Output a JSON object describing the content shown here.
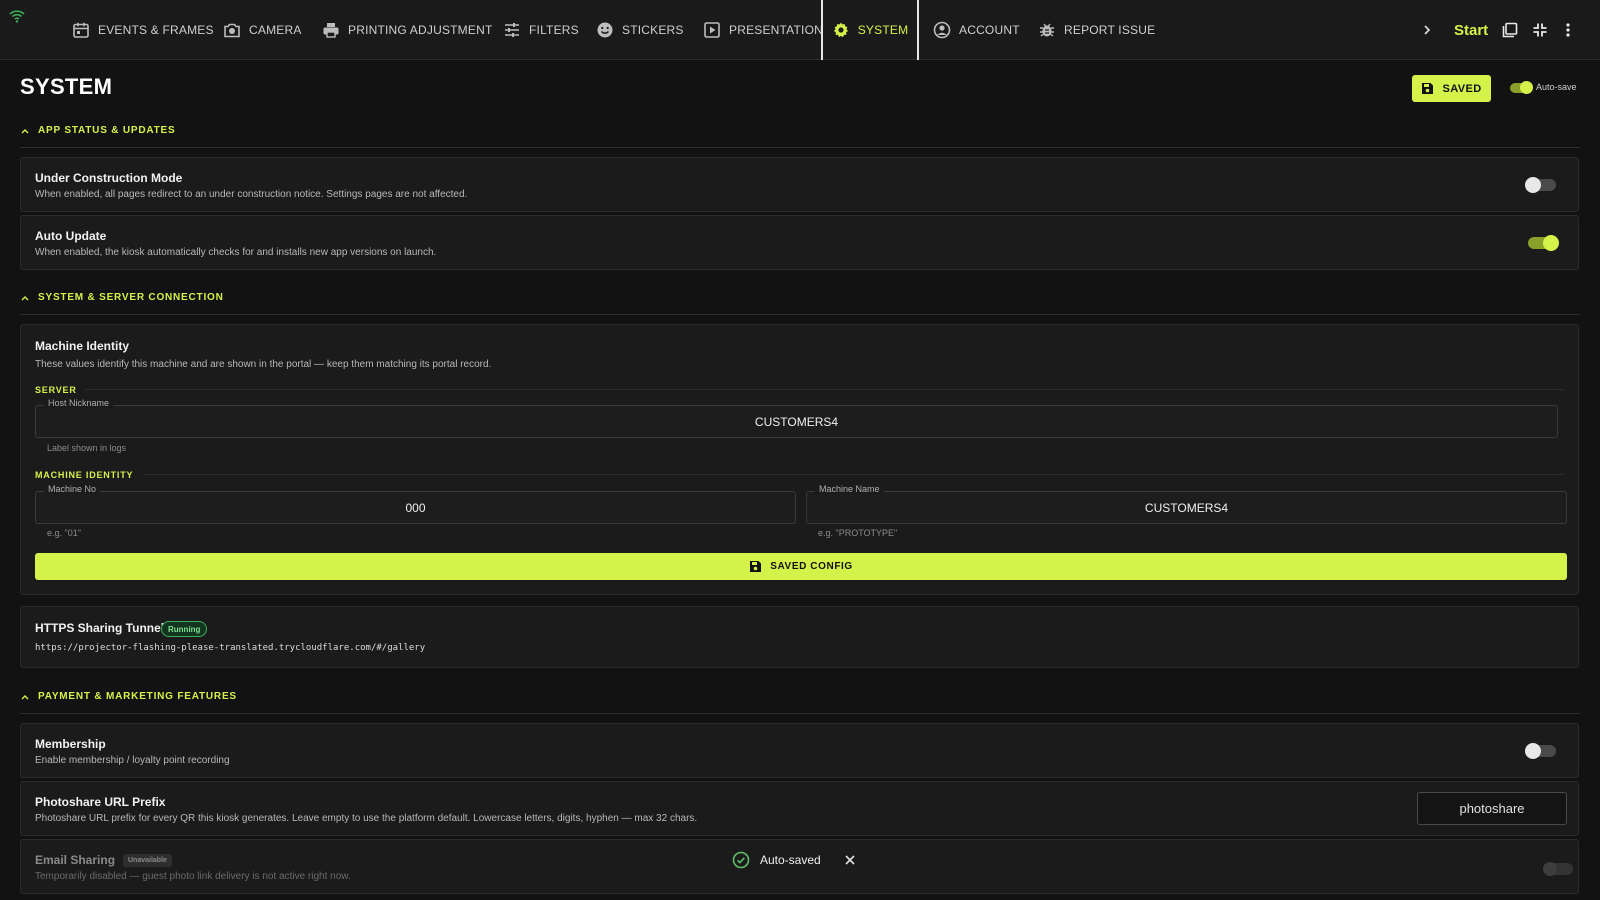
{
  "nav": {
    "tabs": [
      {
        "label": "EVENTS & FRAMES",
        "icon": "calendar-icon"
      },
      {
        "label": "CAMERA",
        "icon": "camera-icon"
      },
      {
        "label": "PRINTING ADJUSTMENT",
        "icon": "printer-icon"
      },
      {
        "label": "FILTERS",
        "icon": "sliders-icon"
      },
      {
        "label": "STICKERS",
        "icon": "smiley-icon"
      },
      {
        "label": "PRESENTATION",
        "icon": "play-icon"
      },
      {
        "label": "SYSTEM",
        "icon": "gear-icon",
        "active": true
      },
      {
        "label": "ACCOUNT",
        "icon": "account-icon"
      },
      {
        "label": "REPORT ISSUE",
        "icon": "bug-icon"
      }
    ],
    "start_label": "Start"
  },
  "page": {
    "title": "SYSTEM",
    "saved_label": "SAVED",
    "autosave_label": "Auto-save",
    "autosave_on": true
  },
  "sections": {
    "app_status": {
      "title": "APP STATUS & UPDATES",
      "under_construction": {
        "title": "Under Construction Mode",
        "desc": "When enabled, all pages redirect to an under construction notice. Settings pages are not affected.",
        "enabled": false
      },
      "auto_update": {
        "title": "Auto Update",
        "desc": "When enabled, the kiosk automatically checks for and installs new app versions on launch.",
        "enabled": true
      }
    },
    "server": {
      "title": "SYSTEM & SERVER CONNECTION",
      "machine_identity_card": {
        "title": "Machine Identity",
        "desc": "These values identify this machine and are shown in the portal — keep them matching its portal record.",
        "server_label": "SERVER",
        "host_nickname": {
          "label": "Host Nickname",
          "value": "CUSTOMERS4",
          "helper": "Label shown in logs"
        },
        "identity_label": "MACHINE IDENTITY",
        "machine_no": {
          "label": "Machine No",
          "value": "000",
          "helper": "e.g. \"01\""
        },
        "machine_name": {
          "label": "Machine Name",
          "value": "CUSTOMERS4",
          "helper": "e.g. \"PROTOTYPE\""
        },
        "save_button": "SAVED CONFIG"
      },
      "tunnel": {
        "title": "HTTPS Sharing Tunnel",
        "status": "Running",
        "url": "https://projector-flashing-please-translated.trycloudflare.com/#/gallery"
      }
    },
    "payment": {
      "title": "PAYMENT & MARKETING FEATURES",
      "membership": {
        "title": "Membership",
        "desc": "Enable membership / loyalty point recording",
        "enabled": false
      },
      "photoshare": {
        "title": "Photoshare URL Prefix",
        "desc": "Photoshare URL prefix for every QR this kiosk generates. Leave empty to use the platform default. Lowercase letters, digits, hyphen — max 32 chars.",
        "value": "photoshare"
      },
      "email": {
        "title": "Email Sharing",
        "badge": "Unavailable",
        "desc": "Temporarily disabled — guest photo link delivery is not active right now.",
        "enabled": false
      }
    }
  },
  "toast": {
    "message": "Auto-saved"
  },
  "colors": {
    "accent": "#d4f24a",
    "background": "#121212",
    "card": "#1b1b1b",
    "success": "#5fbf6a"
  }
}
